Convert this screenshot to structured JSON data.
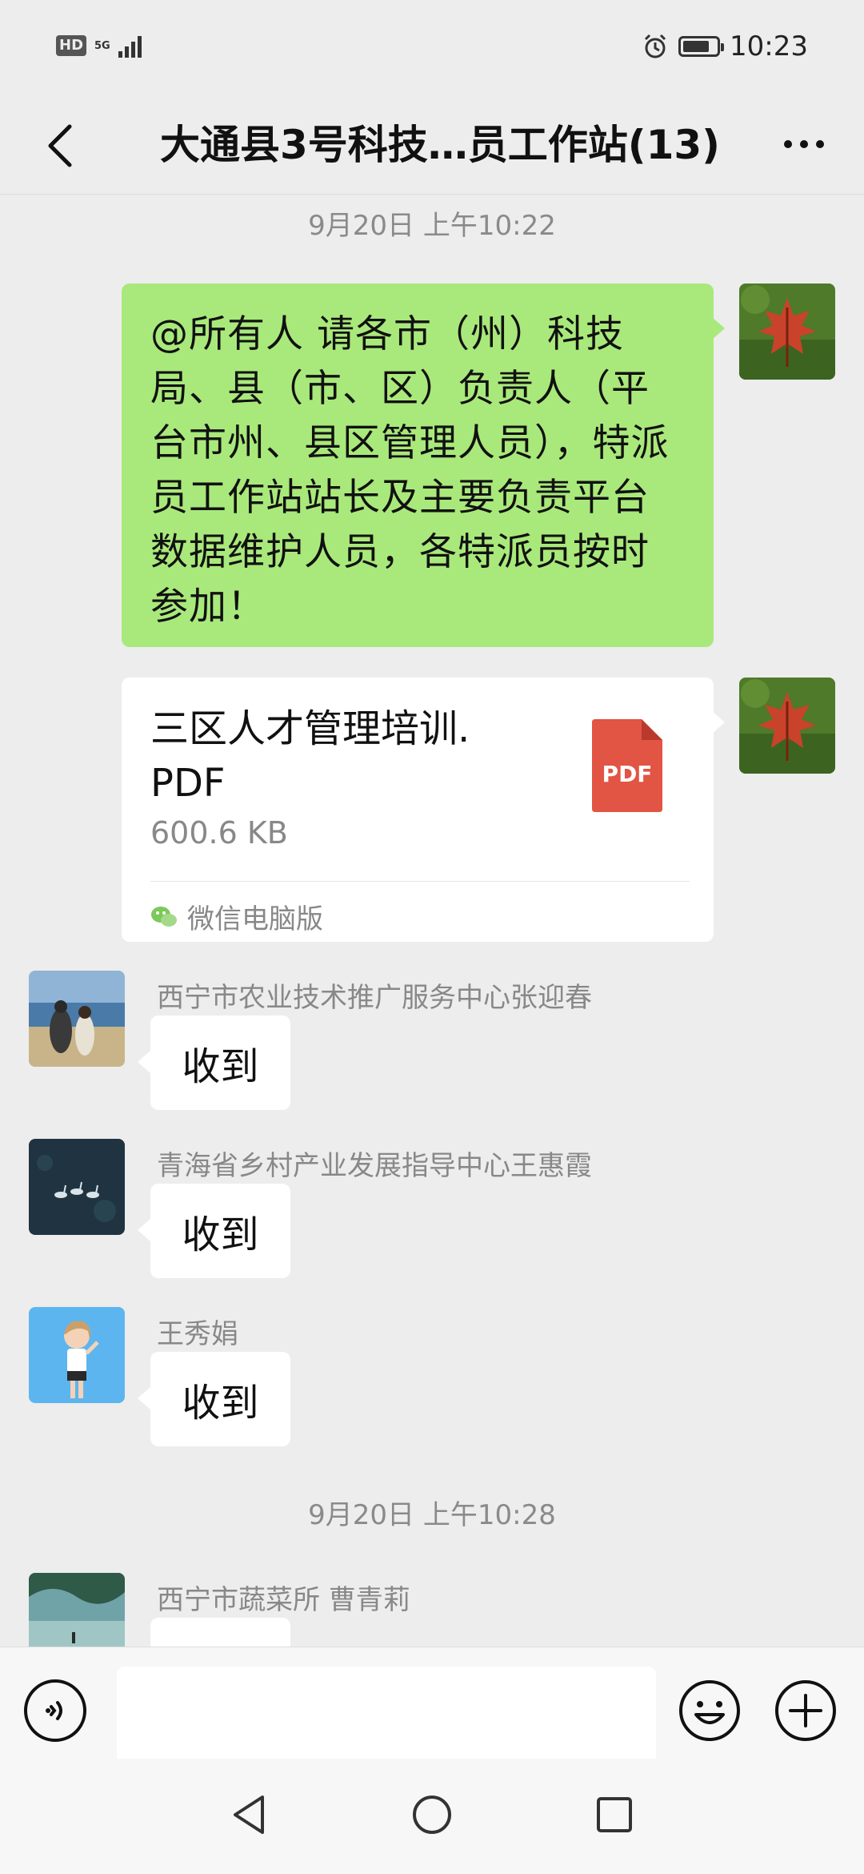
{
  "status_bar": {
    "hd": "HD",
    "network": "5G",
    "time": "10:23",
    "battery_level": 0.8
  },
  "header": {
    "title": "大通县3号科技…员工作站(13)"
  },
  "messages": {
    "timestamp_1": "9月20日 上午10:22",
    "announcement": "@所有人  请各市（州）科技局、县（市、区）负责人（平台市州、县区管理人员），特派员工作站站长及主要负责平台数据维护人员，各特派员按时参加！",
    "file": {
      "name_line1": "三区人才管理培训.",
      "name_line2": "PDF",
      "size": "600.6 KB",
      "file_type_icon_label": "PDF",
      "source": "微信电脑版"
    },
    "reply_1": {
      "sender": "西宁市农业技术推广服务中心张迎春",
      "text": "收到"
    },
    "reply_2": {
      "sender": "青海省乡村产业发展指导中心王惠霞",
      "text": "收到"
    },
    "reply_3": {
      "sender": "王秀娟",
      "text": "收到"
    },
    "timestamp_2": "9月20日 上午10:28",
    "reply_4": {
      "sender": "西宁市蔬菜所  曹青莉"
    }
  },
  "colors": {
    "background": "#ededed",
    "my_bubble": "#a9e97b",
    "pdf_icon": "#e25443"
  }
}
